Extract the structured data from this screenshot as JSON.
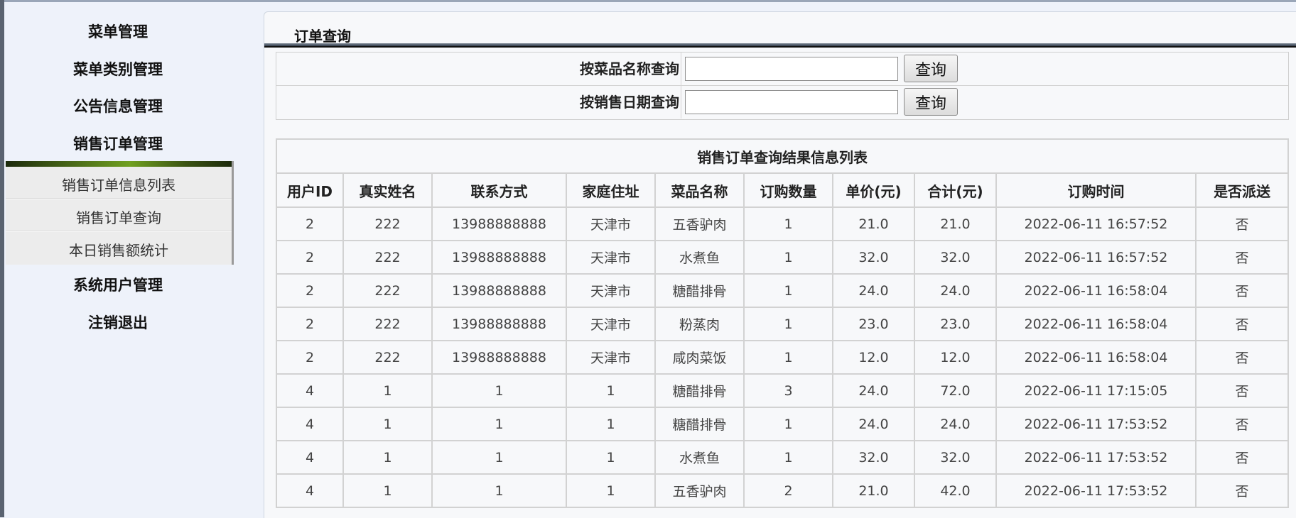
{
  "sidebar": {
    "menu": [
      {
        "label": "菜单管理"
      },
      {
        "label": "菜单类别管理"
      },
      {
        "label": "公告信息管理"
      },
      {
        "label": "销售订单管理"
      },
      {
        "label": "系统用户管理"
      },
      {
        "label": "注销退出"
      }
    ],
    "submenu": [
      {
        "label": "销售订单信息列表"
      },
      {
        "label": "销售订单查询"
      },
      {
        "label": "本日销售额统计"
      }
    ]
  },
  "main": {
    "title": "订单查询",
    "search": {
      "by_name_label": "按菜品名称查询",
      "by_name_value": "",
      "by_date_label": "按销售日期查询",
      "by_date_value": "",
      "button_label": "查询"
    },
    "results": {
      "caption": "销售订单查询结果信息列表",
      "columns": [
        "用户ID",
        "真实姓名",
        "联系方式",
        "家庭住址",
        "菜品名称",
        "订购数量",
        "单价(元)",
        "合计(元)",
        "订购时间",
        "是否派送"
      ],
      "rows": [
        [
          "2",
          "222",
          "13988888888",
          "天津市",
          "五香驴肉",
          "1",
          "21.0",
          "21.0",
          "2022-06-11 16:57:52",
          "否"
        ],
        [
          "2",
          "222",
          "13988888888",
          "天津市",
          "水煮鱼",
          "1",
          "32.0",
          "32.0",
          "2022-06-11 16:57:52",
          "否"
        ],
        [
          "2",
          "222",
          "13988888888",
          "天津市",
          "糖醋排骨",
          "1",
          "24.0",
          "24.0",
          "2022-06-11 16:58:04",
          "否"
        ],
        [
          "2",
          "222",
          "13988888888",
          "天津市",
          "粉蒸肉",
          "1",
          "23.0",
          "23.0",
          "2022-06-11 16:58:04",
          "否"
        ],
        [
          "2",
          "222",
          "13988888888",
          "天津市",
          "咸肉菜饭",
          "1",
          "12.0",
          "12.0",
          "2022-06-11 16:58:04",
          "否"
        ],
        [
          "4",
          "1",
          "1",
          "1",
          "糖醋排骨",
          "3",
          "24.0",
          "72.0",
          "2022-06-11 17:15:05",
          "否"
        ],
        [
          "4",
          "1",
          "1",
          "1",
          "糖醋排骨",
          "1",
          "24.0",
          "24.0",
          "2022-06-11 17:53:52",
          "否"
        ],
        [
          "4",
          "1",
          "1",
          "1",
          "水煮鱼",
          "1",
          "32.0",
          "32.0",
          "2022-06-11 17:53:52",
          "否"
        ],
        [
          "4",
          "1",
          "1",
          "1",
          "五香驴肉",
          "2",
          "21.0",
          "42.0",
          "2022-06-11 17:53:52",
          "否"
        ]
      ]
    }
  }
}
